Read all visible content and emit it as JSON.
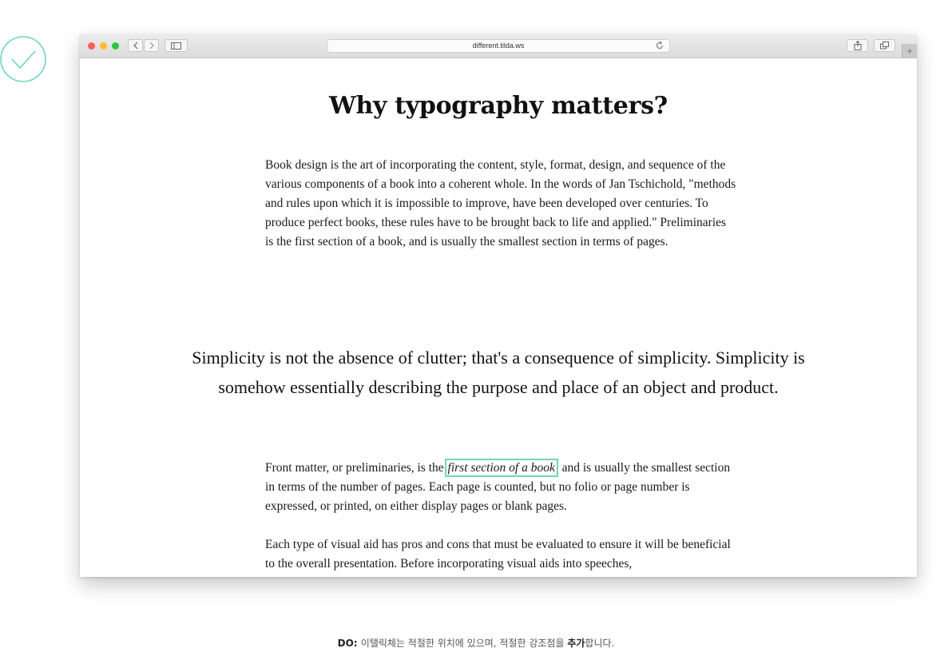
{
  "browser": {
    "url": "different.tilda.ws",
    "new_tab_label": "+"
  },
  "article": {
    "title": "Why typography matters?",
    "paragraph_1": "Book design is the art of incorporating the content, style, format, design, and sequence of the various components of a book into a coherent whole. In the words of Jan Tschichold, \"methods and rules upon which it is impossible to improve, have been developed over centuries. To produce perfect books, these rules have to be brought back to life and applied.\" Preliminaries is the first section of a book, and is usually the smallest section in terms of pages.",
    "quote": "Simplicity is not the absence of clutter; that's a consequence of simplicity. Simplicity is somehow essentially describing the purpose and place of an object and product.",
    "paragraph_2_before": "Front matter, or preliminaries, is the ",
    "paragraph_2_emphasis": "first section of a book",
    "paragraph_2_after": ", and is usually the smallest section in terms of the number of pages. Each page is counted, but no folio or page number is expressed, or printed, on either display pages or blank pages.",
    "paragraph_3": "Each type of visual aid has pros and cons that must be evaluated to ensure it will be beneficial to the overall presentation. Before incorporating visual aids into speeches,"
  },
  "caption": {
    "prefix": "DO: ",
    "text_1": "이탤릭체는 적절한 위치에 있으며, 적절한 강조점을 ",
    "bold": "추가",
    "text_2": "합니다."
  },
  "icons": {
    "check": "check-circle-icon",
    "back": "chevron-left-icon",
    "forward": "chevron-right-icon",
    "sidebar": "sidebar-icon",
    "reload": "reload-icon",
    "share": "share-icon",
    "tabs": "tabs-icon"
  },
  "colors": {
    "accent": "#6fd6bd",
    "close": "#fc5f57",
    "minimize": "#fdbc2e",
    "zoom": "#29c840"
  }
}
